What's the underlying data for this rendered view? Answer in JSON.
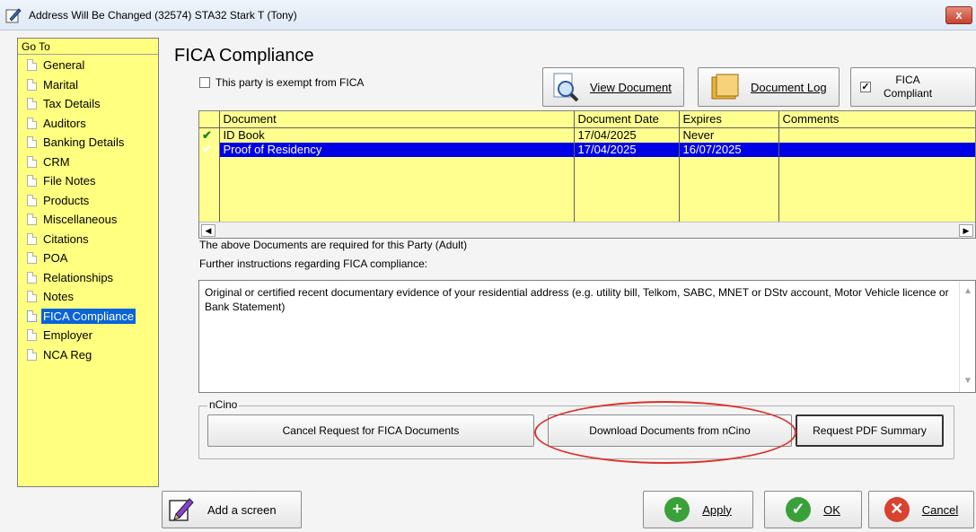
{
  "window": {
    "title": "Address Will Be Changed (32574) STA32 Stark T (Tony)",
    "close_label": "x"
  },
  "goto": {
    "header": "Go To",
    "items": [
      {
        "label": "General"
      },
      {
        "label": "Marital"
      },
      {
        "label": "Tax Details"
      },
      {
        "label": "Auditors"
      },
      {
        "label": "Banking Details"
      },
      {
        "label": "CRM"
      },
      {
        "label": "File Notes"
      },
      {
        "label": "Products"
      },
      {
        "label": "Miscellaneous"
      },
      {
        "label": "Citations"
      },
      {
        "label": "POA"
      },
      {
        "label": "Relationships"
      },
      {
        "label": "Notes"
      },
      {
        "label": "FICA Compliance",
        "selected": true
      },
      {
        "label": "Employer"
      },
      {
        "label": "NCA Reg"
      }
    ]
  },
  "fica": {
    "title": "FICA Compliance",
    "exempt_label": "This party is exempt from FICA",
    "exempt_checked": false,
    "view_document_label": "View Document",
    "document_log_label": "Document Log",
    "compliant_label_line1": "FICA",
    "compliant_label_line2": "Compliant",
    "compliant_checked": true,
    "columns": [
      "Document",
      "Document Date",
      "Expires",
      "Comments"
    ],
    "rows": [
      {
        "mark": "✔",
        "document": "ID Book",
        "date": "17/04/2025",
        "expires": "Never",
        "comments": ""
      },
      {
        "mark": "✔",
        "document": "Proof of Residency",
        "date": "17/04/2025",
        "expires": "16/07/2025",
        "comments": "",
        "selected": true
      }
    ],
    "required_note": "The above Documents are required for this Party (Adult)",
    "instructions_label": "Further instructions regarding FICA compliance:",
    "instructions_text": "Original or certified recent documentary evidence of your residential address (e.g. utility bill, Telkom, SABC, MNET or DStv account, Motor Vehicle licence or Bank Statement)"
  },
  "ncino": {
    "group_label": "nCino",
    "cancel_request_label": "Cancel Request for FICA Documents",
    "download_label": "Download Documents from nCino",
    "pdf_summary_label": "Request PDF Summary"
  },
  "footer": {
    "add_screen_label": "Add a screen",
    "apply_label": "Apply",
    "ok_label": "OK",
    "cancel_label": "Cancel"
  },
  "colors": {
    "goto_bg": "#ffff80",
    "selection": "#0000e6",
    "highlight_ring": "#d9342c",
    "apply_green": "#3aa13a",
    "ok_green": "#3aa13a",
    "cancel_red": "#d9422f"
  }
}
